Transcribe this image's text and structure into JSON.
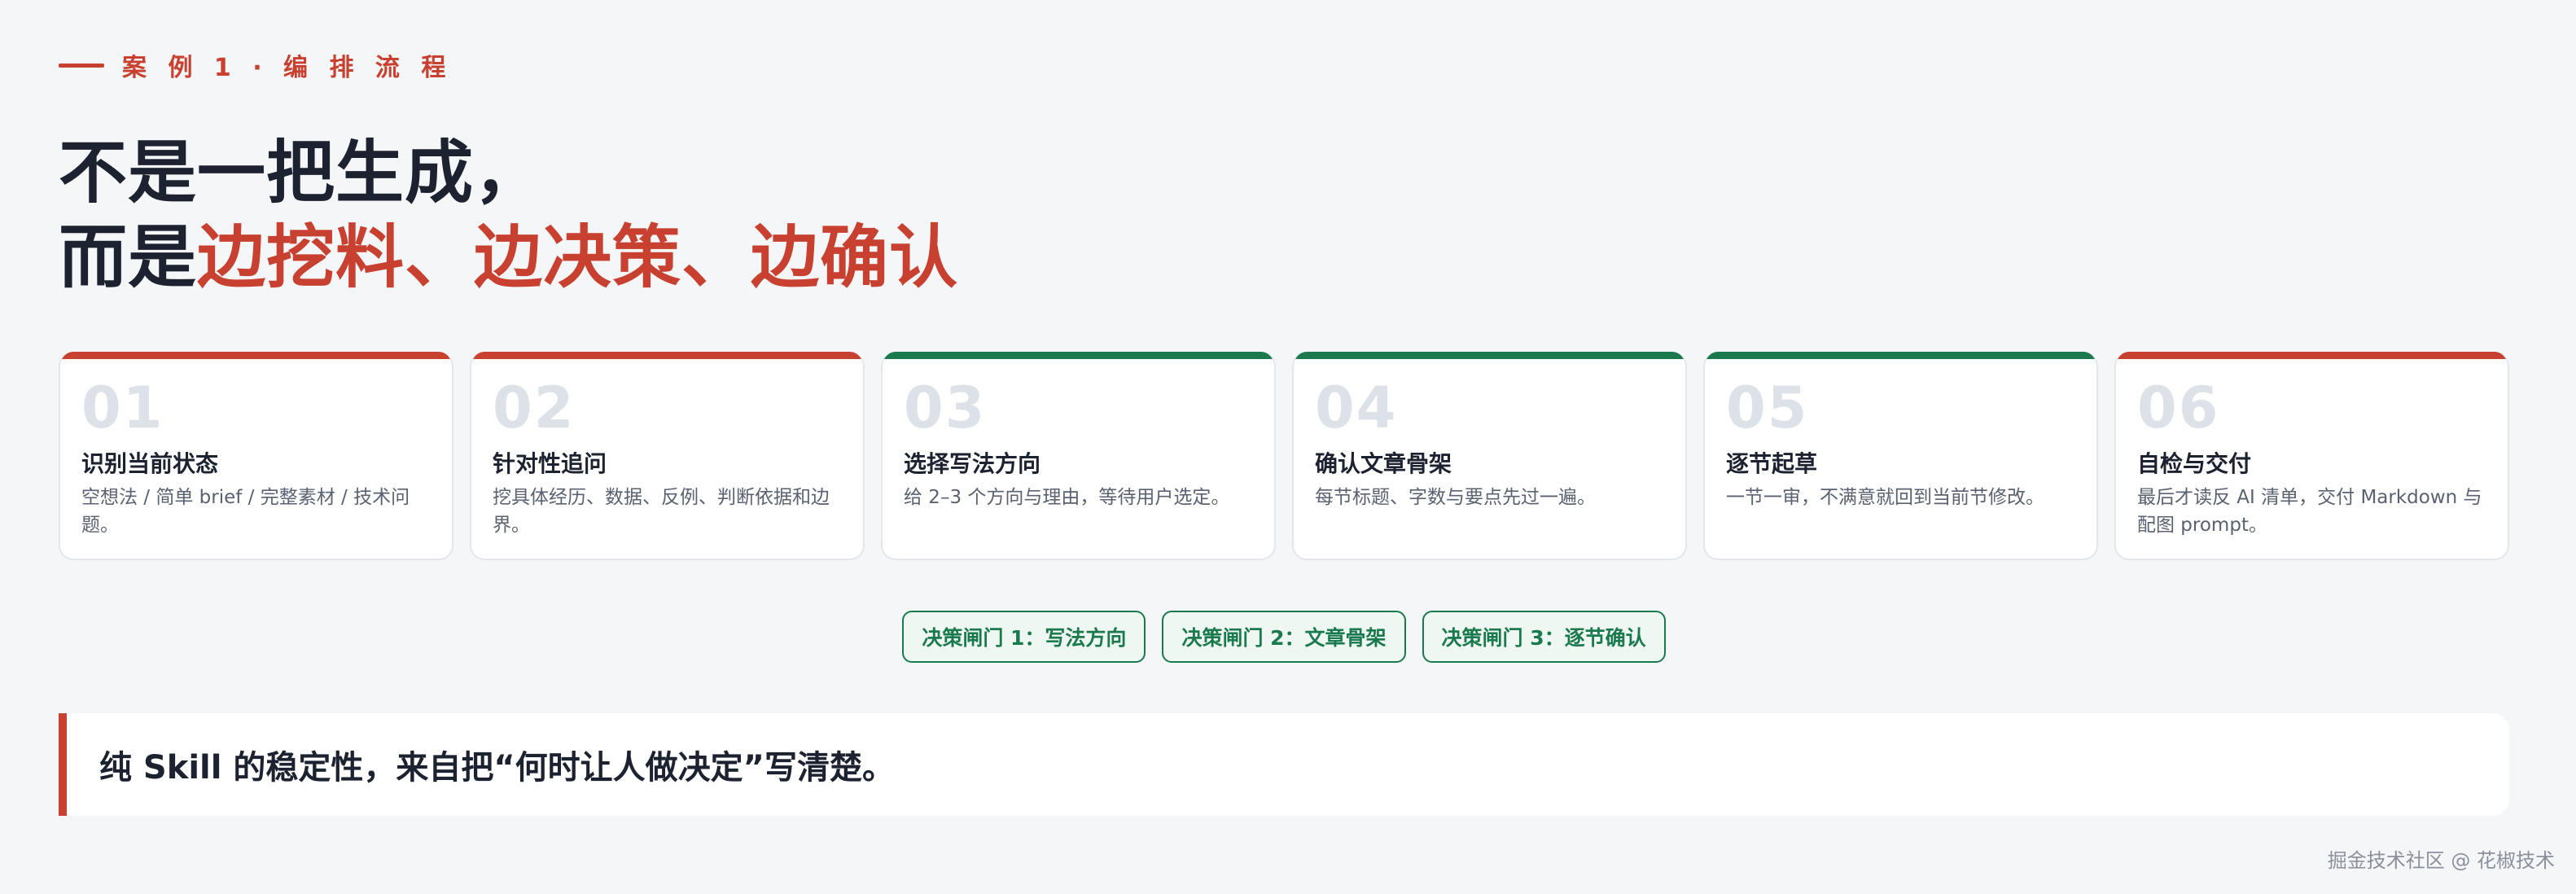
{
  "eyebrow": {
    "text": "案 例 1 · 编 排 流 程"
  },
  "headline": {
    "line1": "不是一把生成，",
    "line2_prefix": "而是",
    "line2_highlight": "边挖料、边决策、边确认"
  },
  "colors": {
    "accent_red": "#c8402f",
    "accent_green": "#1a7a4e",
    "text_dark": "#1d2230",
    "background": "#f5f6f8"
  },
  "steps": [
    {
      "num": "01",
      "title": "识别当前状态",
      "desc": "空想法 / 简单 brief / 完整素材 / 技术问题。",
      "accent": "#c8402f"
    },
    {
      "num": "02",
      "title": "针对性追问",
      "desc": "挖具体经历、数据、反例、判断依据和边界。",
      "accent": "#c8402f"
    },
    {
      "num": "03",
      "title": "选择写法方向",
      "desc": "给 2–3 个方向与理由，等待用户选定。",
      "accent": "#1a7a4e"
    },
    {
      "num": "04",
      "title": "确认文章骨架",
      "desc": "每节标题、字数与要点先过一遍。",
      "accent": "#1a7a4e"
    },
    {
      "num": "05",
      "title": "逐节起草",
      "desc": "一节一审，不满意就回到当前节修改。",
      "accent": "#1a7a4e"
    },
    {
      "num": "06",
      "title": "自检与交付",
      "desc": "最后才读反 AI 清单，交付 Markdown 与配图 prompt。",
      "accent": "#c8402f"
    }
  ],
  "gates": [
    "决策闸门 1：写法方向",
    "决策闸门 2：文章骨架",
    "决策闸门 3：逐节确认"
  ],
  "quote": {
    "text": "纯 Skill 的稳定性，来自把“何时让人做决定”写清楚。"
  },
  "watermark": {
    "text": "掘金技术社区 @ 花椒技术"
  }
}
